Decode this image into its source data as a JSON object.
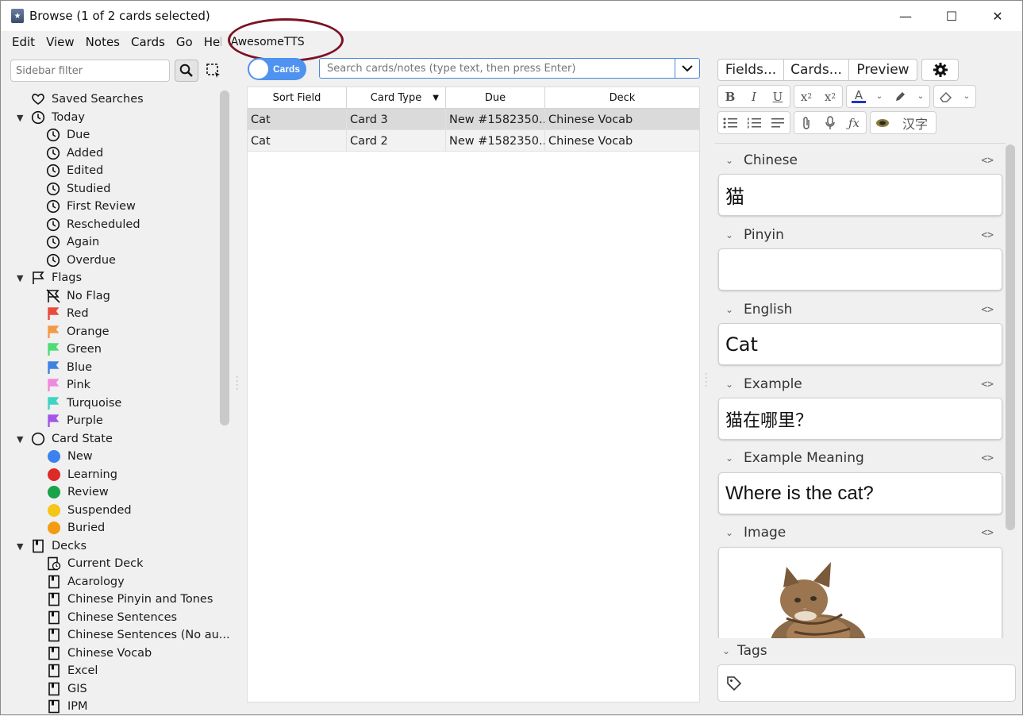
{
  "window": {
    "title": "Browse (1 of 2 cards selected)",
    "controls": {
      "minimize": "—",
      "maximize": "☐",
      "close": "✕"
    }
  },
  "menu": {
    "items": [
      "Edit",
      "View",
      "Notes",
      "Cards",
      "Go",
      "Help",
      "AwesomeTTS"
    ],
    "highlighted": "AwesomeTTS"
  },
  "sidebar": {
    "filter_placeholder": "Sidebar filter",
    "saved_searches": "Saved Searches",
    "today": {
      "label": "Today",
      "items": [
        "Due",
        "Added",
        "Edited",
        "Studied",
        "First Review",
        "Rescheduled",
        "Again",
        "Overdue"
      ]
    },
    "flags": {
      "label": "Flags",
      "no_flag": "No Flag",
      "items": [
        {
          "label": "Red",
          "color": "#e84a3b"
        },
        {
          "label": "Orange",
          "color": "#f29a47"
        },
        {
          "label": "Green",
          "color": "#4fdc76"
        },
        {
          "label": "Blue",
          "color": "#3f82e0"
        },
        {
          "label": "Pink",
          "color": "#ee8ade"
        },
        {
          "label": "Turquoise",
          "color": "#3fd3c2"
        },
        {
          "label": "Purple",
          "color": "#a456e6"
        }
      ]
    },
    "card_state": {
      "label": "Card State",
      "items": [
        {
          "label": "New",
          "color": "#3b82f0"
        },
        {
          "label": "Learning",
          "color": "#dc2a26"
        },
        {
          "label": "Review",
          "color": "#16a34a"
        },
        {
          "label": "Suspended",
          "color": "#f5c518"
        },
        {
          "label": "Buried",
          "color": "#f39c12"
        }
      ]
    },
    "decks": {
      "label": "Decks",
      "current": "Current Deck",
      "items": [
        "Acarology",
        "Chinese Pinyin and Tones",
        "Chinese Sentences",
        "Chinese Sentences (No au...",
        "Chinese Vocab",
        "Excel",
        "GIS",
        "IPM"
      ]
    }
  },
  "browser": {
    "toggle_label": "Cards",
    "search_placeholder": "Search cards/notes (type text, then press Enter)",
    "columns": [
      "Sort Field",
      "Card Type",
      "Due",
      "Deck"
    ],
    "rows": [
      [
        "Cat",
        "Card 3",
        "New #1582350...",
        "Chinese Vocab"
      ],
      [
        "Cat",
        "Card 2",
        "New #1582350...",
        "Chinese Vocab"
      ]
    ]
  },
  "editor": {
    "tabs": [
      "Fields...",
      "Cards...",
      "Preview"
    ],
    "hanzi_button": "汉字",
    "fields": [
      {
        "name": "Chinese",
        "value": "猫"
      },
      {
        "name": "Pinyin",
        "value": ""
      },
      {
        "name": "English",
        "value": "Cat"
      },
      {
        "name": "Example",
        "value": "猫在哪里？"
      },
      {
        "name": "Example Meaning",
        "value": "Where is the cat?"
      },
      {
        "name": "Image",
        "value": ""
      }
    ],
    "tags_label": "Tags",
    "accent_color": "#1f35c7"
  }
}
